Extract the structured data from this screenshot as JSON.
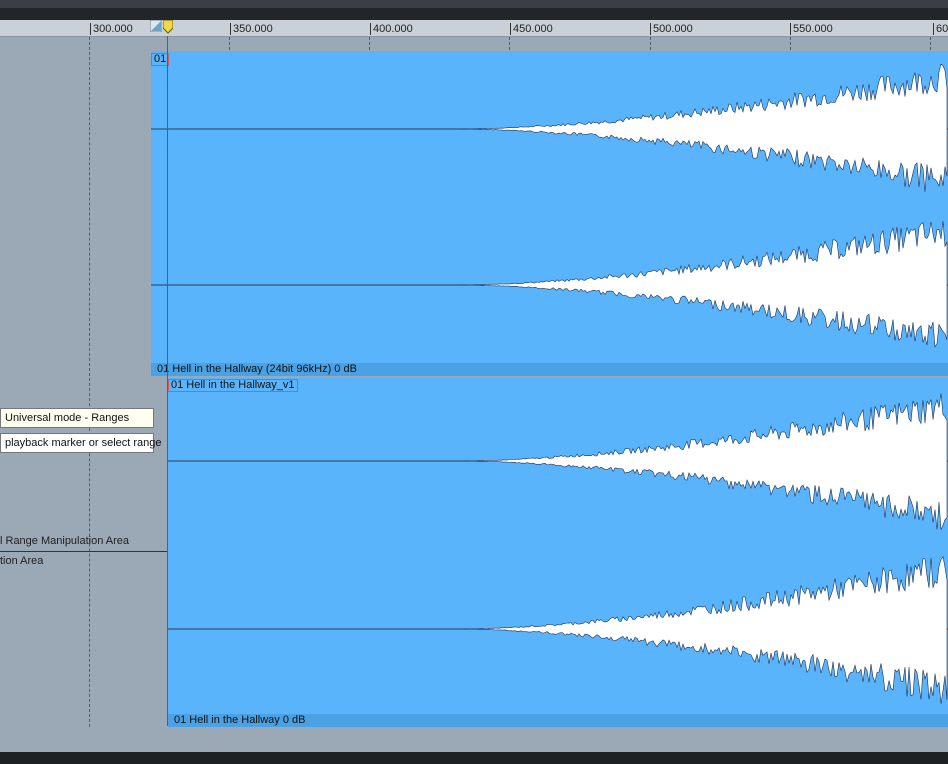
{
  "ruler": {
    "ticks": [
      "300.000",
      "350.000",
      "400.000",
      "450.000",
      "500.000",
      "550.000",
      "60"
    ]
  },
  "clips": {
    "top": {
      "badge": "01",
      "footer": "01 Hell in the Hallway (24bit 96kHz)   0 dB"
    },
    "bottom": {
      "label": "01 Hell in the Hallway_v1",
      "footer": "01 Hell in the Hallway   0 dB"
    }
  },
  "tooltips": {
    "mode": "Universal mode - Ranges",
    "hint": "playback marker or select range"
  },
  "left_labels": {
    "range_area": "l Range Manipulation Area",
    "tion_area": "tion Area"
  },
  "colors": {
    "clip_fill": "#5ab4fb",
    "waveform": "#ffffff",
    "waveform_outline": "#1c2f55",
    "playhead": "#c0352a",
    "playhead_handle": "#f4d84a"
  },
  "icons": {
    "playhead": "playhead-marker-icon",
    "corner": "clip-corner-icon"
  }
}
